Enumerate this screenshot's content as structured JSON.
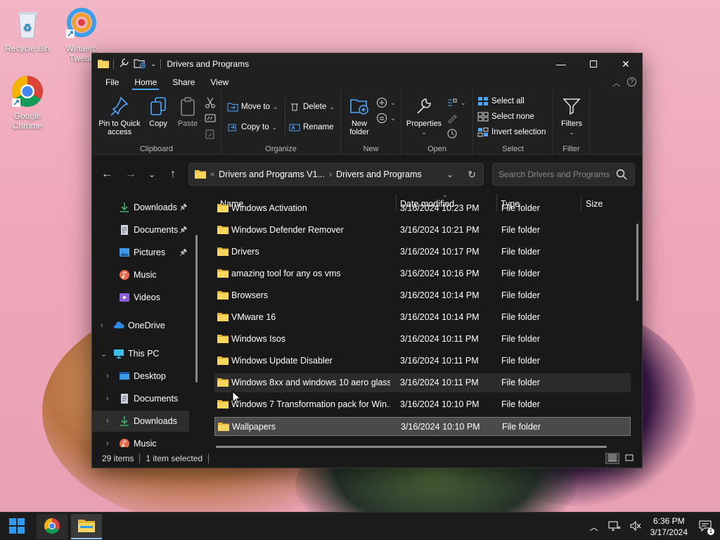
{
  "desktop": {
    "icons": [
      {
        "label": "Recycle Bin",
        "icon": "recycle-bin-icon"
      },
      {
        "label": "Winaero Tweak",
        "icon": "winaero-tweaker-icon"
      },
      {
        "label": "Google Chrome",
        "icon": "chrome-icon"
      }
    ]
  },
  "window": {
    "title": "Drivers and Programs",
    "controls": {
      "minimize": "minimize-icon",
      "maximize": "maximize-icon",
      "close": "close-icon"
    }
  },
  "menu_tabs": [
    "File",
    "Home",
    "Share",
    "View"
  ],
  "active_tab": "Home",
  "ribbon": {
    "clipboard": {
      "name": "Clipboard",
      "pin_label": "Pin to Quick access",
      "copy_label": "Copy",
      "paste_label": "Paste"
    },
    "organize": {
      "name": "Organize",
      "move_to": "Move to",
      "copy_to": "Copy to",
      "delete": "Delete",
      "rename": "Rename"
    },
    "new": {
      "name": "New",
      "new_folder": "New folder"
    },
    "open": {
      "name": "Open",
      "properties": "Properties"
    },
    "select": {
      "name": "Select",
      "select_all": "Select all",
      "select_none": "Select none",
      "invert_selection": "Invert selection"
    },
    "filter": {
      "name": "Filter",
      "filters": "Filters"
    }
  },
  "address": {
    "segments": [
      "Drivers and Programs V1...",
      "Drivers and Programs"
    ],
    "search_placeholder": "Search Drivers and Programs"
  },
  "nav_pane": [
    {
      "label": "Downloads",
      "icon": "download-icon",
      "pinned": true,
      "indent": 2,
      "chevron": false
    },
    {
      "label": "Documents",
      "icon": "document-icon",
      "pinned": true,
      "indent": 2,
      "chevron": false
    },
    {
      "label": "Pictures",
      "icon": "pictures-icon",
      "pinned": true,
      "indent": 2,
      "chevron": false
    },
    {
      "label": "Music",
      "icon": "music-icon",
      "pinned": false,
      "indent": 2,
      "chevron": false
    },
    {
      "label": "Videos",
      "icon": "videos-icon",
      "pinned": false,
      "indent": 2,
      "chevron": false
    },
    {
      "label": "OneDrive",
      "icon": "onedrive-icon",
      "pinned": false,
      "indent": 1,
      "chevron": "right"
    },
    {
      "label": "This PC",
      "icon": "this-pc-icon",
      "pinned": false,
      "indent": 1,
      "chevron": "down"
    },
    {
      "label": "Desktop",
      "icon": "desktop-icon",
      "pinned": false,
      "indent": 2,
      "chevron": "right"
    },
    {
      "label": "Documents",
      "icon": "document-icon",
      "pinned": false,
      "indent": 2,
      "chevron": "right"
    },
    {
      "label": "Downloads",
      "icon": "download-icon",
      "pinned": false,
      "indent": 2,
      "chevron": "right",
      "selected": true
    },
    {
      "label": "Music",
      "icon": "music-icon",
      "pinned": false,
      "indent": 2,
      "chevron": "right"
    }
  ],
  "columns": {
    "name": "Name",
    "date": "Date modified",
    "type": "Type",
    "size": "Size"
  },
  "files": [
    {
      "name": "Windows Activation",
      "date": "3/16/2024 10:23 PM",
      "type": "File folder",
      "size": ""
    },
    {
      "name": "Windows Defender Remover",
      "date": "3/16/2024 10:21 PM",
      "type": "File folder",
      "size": ""
    },
    {
      "name": "Drivers",
      "date": "3/16/2024 10:17 PM",
      "type": "File folder",
      "size": ""
    },
    {
      "name": "amazing tool for any os vms",
      "date": "3/16/2024 10:16 PM",
      "type": "File folder",
      "size": ""
    },
    {
      "name": "Browsers",
      "date": "3/16/2024 10:14 PM",
      "type": "File folder",
      "size": ""
    },
    {
      "name": "VMware 16",
      "date": "3/16/2024 10:14 PM",
      "type": "File folder",
      "size": ""
    },
    {
      "name": "Windows Isos",
      "date": "3/16/2024 10:11 PM",
      "type": "File folder",
      "size": ""
    },
    {
      "name": "Windows Update Disabler",
      "date": "3/16/2024 10:11 PM",
      "type": "File folder",
      "size": ""
    },
    {
      "name": "Windows 8xx and windows 10 aero glass",
      "date": "3/16/2024 10:11 PM",
      "type": "File folder",
      "size": "",
      "state": "hover"
    },
    {
      "name": "Windows 7 Transformation pack for Win...",
      "date": "3/16/2024 10:10 PM",
      "type": "File folder",
      "size": ""
    },
    {
      "name": "Wallpapers",
      "date": "3/16/2024 10:10 PM",
      "type": "File folder",
      "size": "",
      "state": "selected"
    }
  ],
  "status": {
    "item_count": "29 items",
    "selection": "1 item selected"
  },
  "taskbar": {
    "apps": [
      "start-icon",
      "chrome-icon",
      "file-explorer-icon"
    ],
    "active_app": "file-explorer-icon",
    "time": "6:36 PM",
    "date": "3/17/2024"
  },
  "colors": {
    "window_bg": "#191919",
    "ribbon_bg": "#202020",
    "accent": "#4ea6ff",
    "folder": "#f3c84a",
    "taskbar": "#1c1c1c"
  }
}
